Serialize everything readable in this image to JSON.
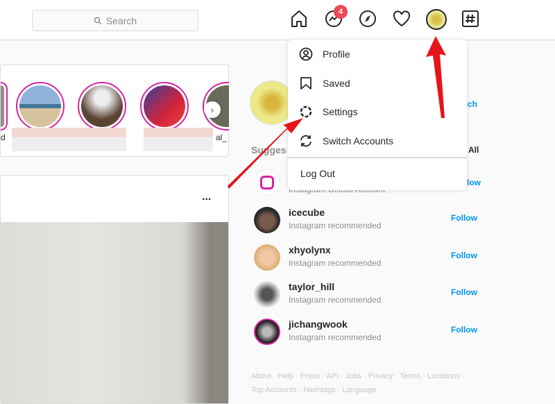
{
  "nav": {
    "search_placeholder": "Search",
    "messages_badge": "4",
    "icons": [
      "home-icon",
      "messenger-icon",
      "explore-icon",
      "heart-icon",
      "profile-avatar",
      "hashtag-icon"
    ]
  },
  "stories": {
    "visible_label_fragments": [
      "d",
      "al_"
    ]
  },
  "post": {
    "more_label": "..."
  },
  "menu": {
    "items": [
      {
        "label": "Profile",
        "icon": "profile-icon"
      },
      {
        "label": "Saved",
        "icon": "bookmark-icon"
      },
      {
        "label": "Settings",
        "icon": "settings-gear-icon"
      },
      {
        "label": "Switch Accounts",
        "icon": "switch-icon"
      }
    ],
    "logout": "Log Out"
  },
  "sidebar": {
    "switch_fragment": "tch",
    "suggestions_fragment": "Sugges",
    "see_all_fragment": "All",
    "instagram_sub": "Instagram Official Account",
    "instagram_follow_fragment": "low",
    "suggestions": [
      {
        "username": "icecube",
        "sub": "Instagram recommended",
        "action": "Follow"
      },
      {
        "username": "xhyolynx",
        "sub": "Instagram recommended",
        "action": "Follow"
      },
      {
        "username": "taylor_hill",
        "sub": "Instagram recommended",
        "action": "Follow"
      },
      {
        "username": "jichangwook",
        "sub": "Instagram recommended",
        "action": "Follow"
      }
    ],
    "footer_line1": "About · Help · Press · API · Jobs · Privacy · Terms · Locations ·",
    "footer_line2": "Top Accounts · Hashtags · Language"
  },
  "colors": {
    "accent": "#0095f6",
    "badge": "#ed4956",
    "annotation_arrow": "#e8141b",
    "story_ring": "#d6249f"
  }
}
